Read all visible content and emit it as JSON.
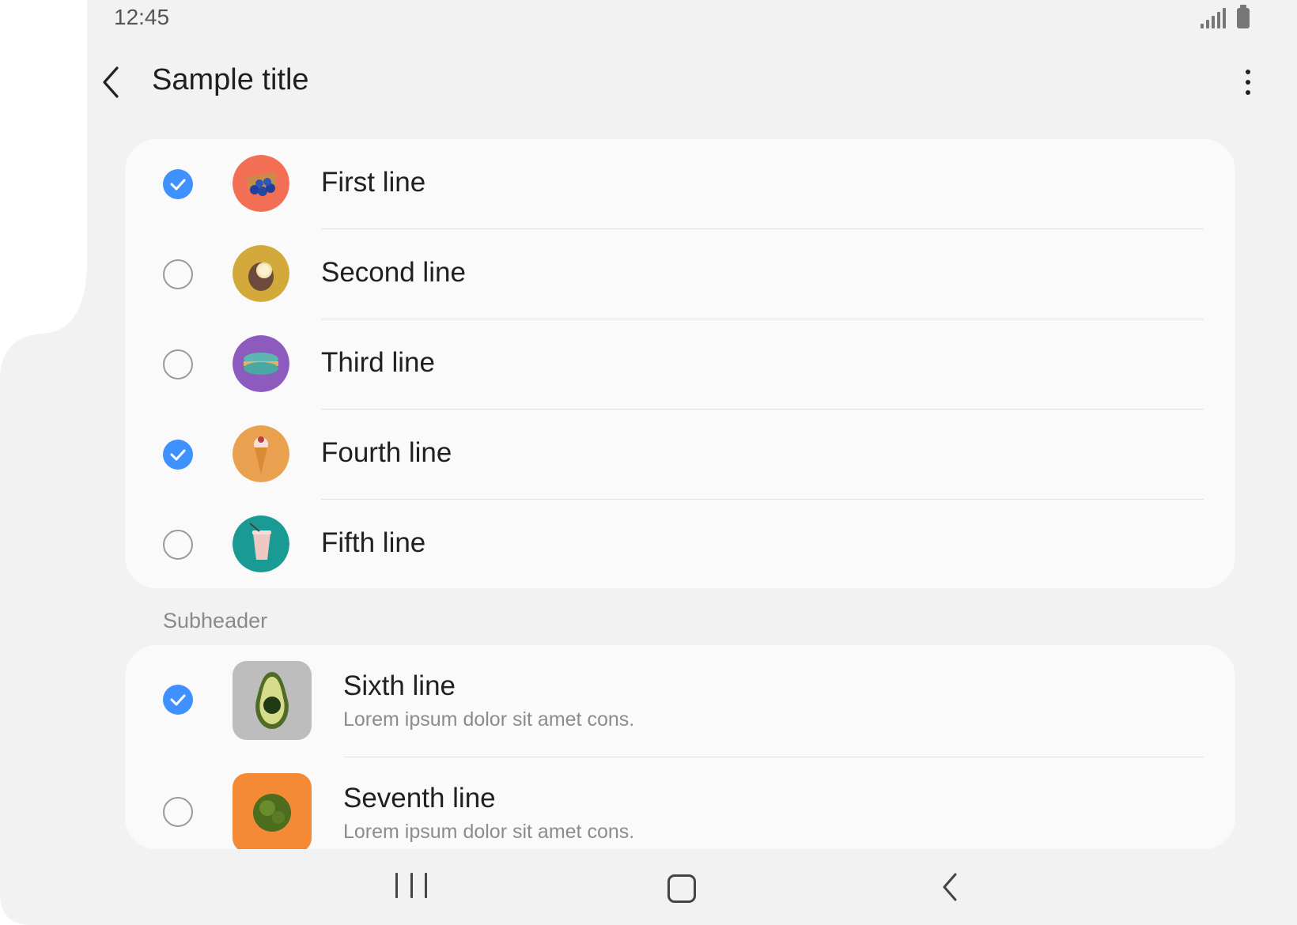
{
  "status_bar": {
    "time": "12:45",
    "signal_icon": "signal-icon",
    "battery_icon": "battery-icon"
  },
  "app_bar": {
    "title": "Sample title",
    "back_icon": "chevron-left-icon",
    "more_icon": "more-vertical-icon"
  },
  "colors": {
    "accent": "#3e91ff",
    "card": "#fafafa",
    "background": "#f2f2f2"
  },
  "list1": {
    "items": [
      {
        "label": "First line",
        "checked": true,
        "avatar": "blueberries-icon",
        "avatar_color": "#f26f55"
      },
      {
        "label": "Second line",
        "checked": false,
        "avatar": "coconut-icon",
        "avatar_color": "#d2a93a"
      },
      {
        "label": "Third line",
        "checked": false,
        "avatar": "macaron-icon",
        "avatar_color": "#8c5bbd"
      },
      {
        "label": "Fourth line",
        "checked": true,
        "avatar": "ice-cream-icon",
        "avatar_color": "#e9a150"
      },
      {
        "label": "Fifth line",
        "checked": false,
        "avatar": "drink-cup-icon",
        "avatar_color": "#1a9a94"
      }
    ]
  },
  "subheader": "Subheader",
  "list2": {
    "items": [
      {
        "label": "Sixth line",
        "sublabel": "Lorem ipsum dolor sit amet cons.",
        "checked": true,
        "thumb": "avocado-icon",
        "thumb_color": "#bdbdbd"
      },
      {
        "label": "Seventh line",
        "sublabel": "Lorem ipsum dolor sit amet cons.",
        "checked": false,
        "thumb": "moss-ball-icon",
        "thumb_color": "#f48a35"
      }
    ]
  },
  "nav_bar": {
    "recents_icon": "recents-icon",
    "home_icon": "home-icon",
    "back_icon": "back-icon"
  }
}
